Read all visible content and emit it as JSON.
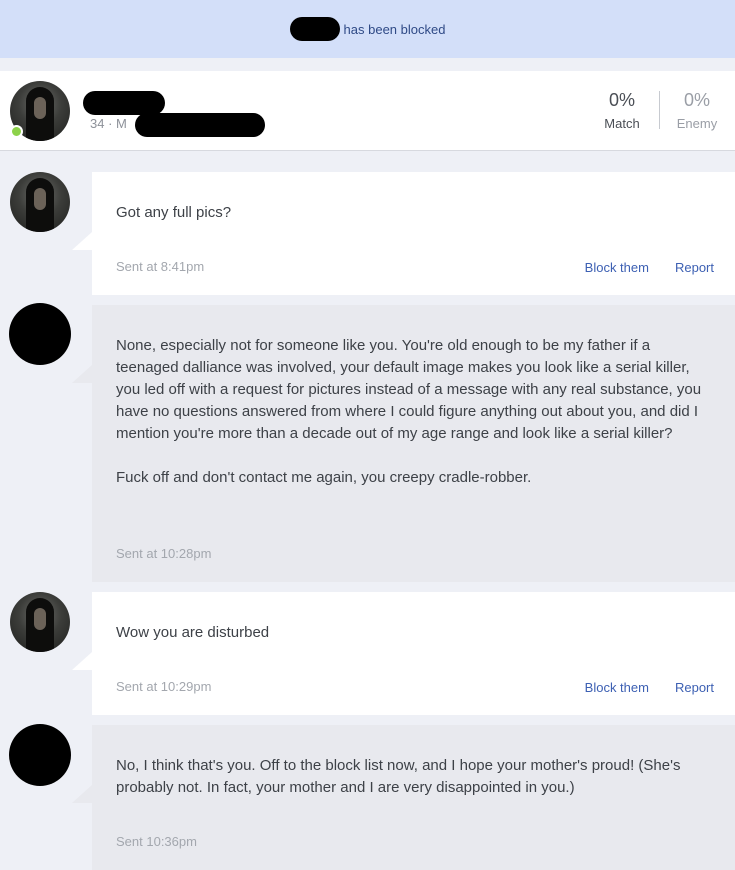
{
  "banner": {
    "text": "has been blocked"
  },
  "profile": {
    "meta": "34 · M",
    "match": {
      "value": "0%",
      "label": "Match"
    },
    "enemy": {
      "value": "0%",
      "label": "Enemy"
    }
  },
  "messages": [
    {
      "from": "them",
      "text": [
        "Got any full pics?"
      ],
      "time": "Sent at 8:41pm",
      "actions": {
        "block": "Block them",
        "report": "Report"
      }
    },
    {
      "from": "me",
      "text": [
        "None, especially not for someone like you. You're old enough to be my father if a teenaged dalliance was involved, your default image makes you look like a serial killer, you led off with a request for pictures instead of a message with any real substance, you have no questions answered from where I could figure anything out about you, and did I mention you're more than a decade out of my age range and look like a serial killer?",
        "Fuck off and don't contact me again, you creepy cradle-robber."
      ],
      "time": "Sent at 10:28pm"
    },
    {
      "from": "them",
      "text": [
        "Wow you are disturbed"
      ],
      "time": "Sent at 10:29pm",
      "actions": {
        "block": "Block them",
        "report": "Report"
      }
    },
    {
      "from": "me",
      "text": [
        "No, I think that's you. Off to the block list now, and I hope your mother's proud! (She's probably not. In fact, your mother and I are very disappointed in you.)"
      ],
      "time": "Sent 10:36pm"
    }
  ]
}
